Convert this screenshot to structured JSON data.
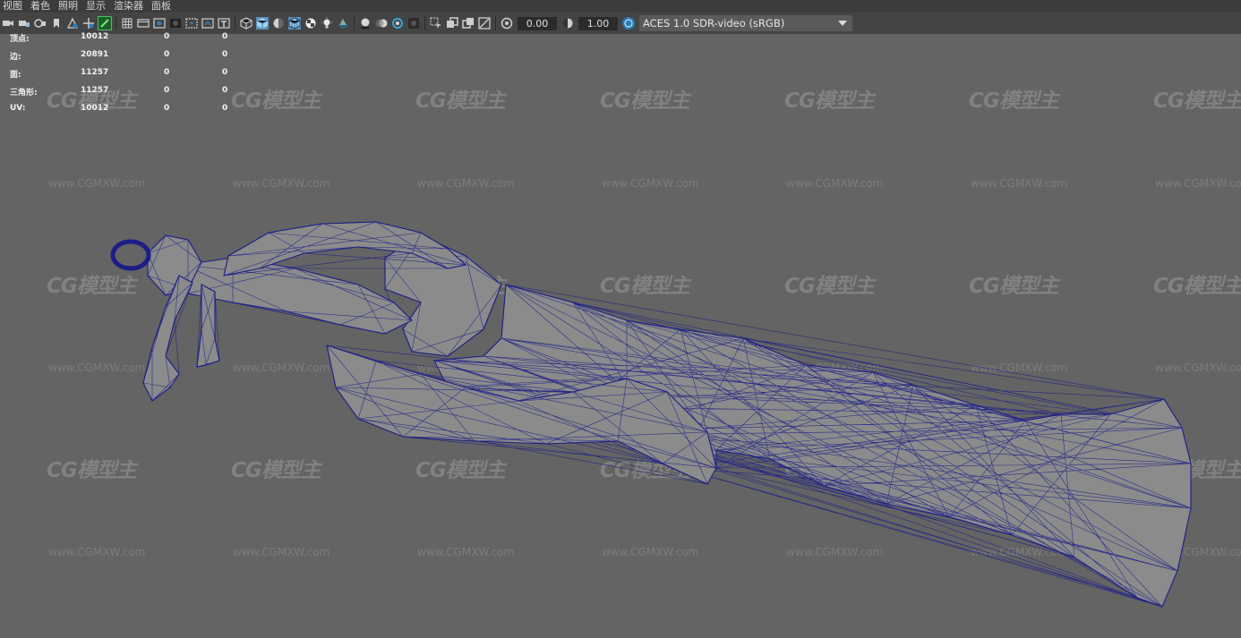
{
  "menubar": {
    "items": [
      "视图",
      "着色",
      "照明",
      "显示",
      "渲染器",
      "面板"
    ]
  },
  "toolbar": {
    "icons": [
      "camera-icon",
      "camera-lock-icon",
      "camera-attributes-icon",
      "bookmark-icon",
      "image-plane-icon",
      "two-d-pan-icon",
      "grease-pencil-icon",
      "grid-icon",
      "film-gate-icon",
      "resolution-gate-icon",
      "gate-mask-icon",
      "field-chart-icon",
      "safe-action-icon",
      "safe-title-icon",
      "wireframe-icon",
      "smooth-shade-icon",
      "default-material-icon",
      "wireframe-on-shaded-icon",
      "textured-icon",
      "use-lights-icon",
      "shadows-icon",
      "screen-space-ao-icon",
      "motion-blur-icon",
      "anti-aliasing-icon",
      "depth-of-field-icon",
      "isolate-select-icon",
      "xray-icon",
      "xray-joints-icon",
      "backface-icon",
      "exposure-icon",
      "gamma-icon",
      "color-management-icon"
    ],
    "exposure_value": "0.00",
    "gamma_value": "1.00",
    "color_space": "ACES 1.0 SDR-video (sRGB)"
  },
  "hud": {
    "rows": [
      {
        "label": "顶点:",
        "v1": "10012",
        "v2": "0",
        "v3": "0"
      },
      {
        "label": "边:",
        "v1": "20891",
        "v2": "0",
        "v3": "0"
      },
      {
        "label": "面:",
        "v1": "11257",
        "v2": "0",
        "v3": "0"
      },
      {
        "label": "三角形:",
        "v1": "11257",
        "v2": "0",
        "v3": "0"
      },
      {
        "label": "UV:",
        "v1": "10012",
        "v2": "0",
        "v3": "0"
      }
    ]
  },
  "watermark": {
    "logo": "CG模型主",
    "url": "www.CGMXW.com"
  },
  "colors": {
    "viewport_bg": "#646464",
    "wire": "#1c1e86",
    "mesh_fill": "#8b8b8b"
  }
}
